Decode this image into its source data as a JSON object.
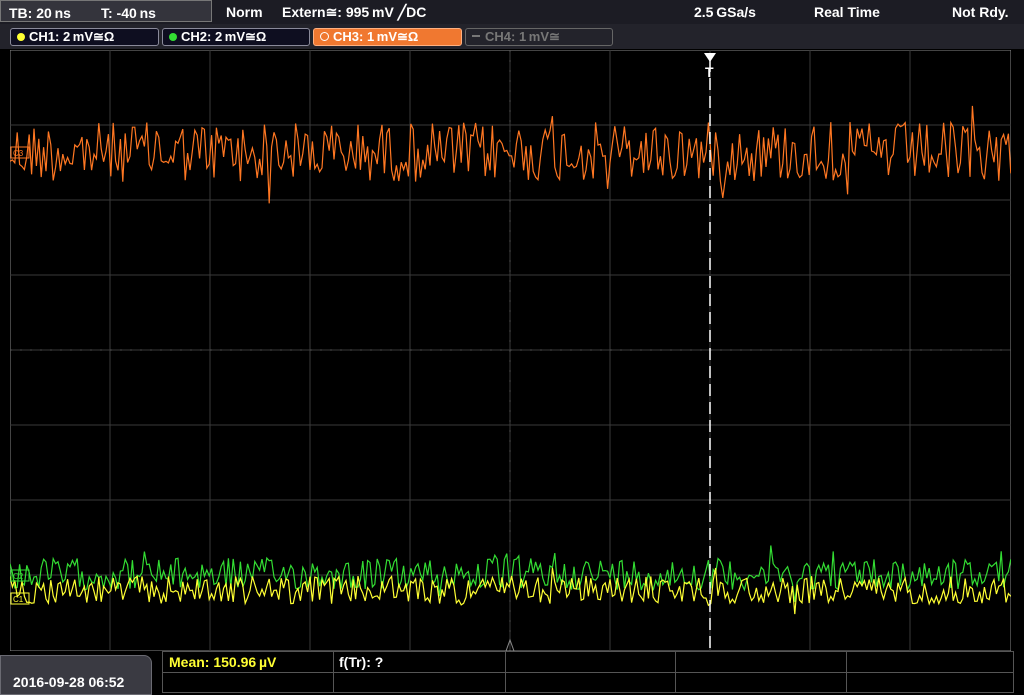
{
  "status_bar": {
    "timebase": "TB: 20 ns",
    "trigger_time": "T: -40 ns",
    "mode": "Norm",
    "trigger_source": "Extern≅: 995 mV ╱DC",
    "sample_rate": "2.5 GSa/s",
    "acq_mode": "Real Time",
    "status": "Not Rdy."
  },
  "channels": [
    {
      "label": "CH1: 2 mV≅Ω",
      "color": "#ffff33",
      "active": true
    },
    {
      "label": "CH2: 2 mV≅Ω",
      "color": "#33dd33",
      "active": true
    },
    {
      "label": "CH3: 1 mV≅Ω",
      "color": "#ff7722",
      "active": true,
      "selected": true
    },
    {
      "label": "CH4: 1 mV≅",
      "color": "#777777",
      "active": false
    }
  ],
  "markers": {
    "ch3": "C3",
    "ch2": "C2",
    "ch1": "C1",
    "trigger": "T"
  },
  "bottom": {
    "datetime": "2016-09-28 06:52",
    "mean_label": "Mean: 150.96 µV",
    "freq_label": "f(Tr): ?"
  }
}
